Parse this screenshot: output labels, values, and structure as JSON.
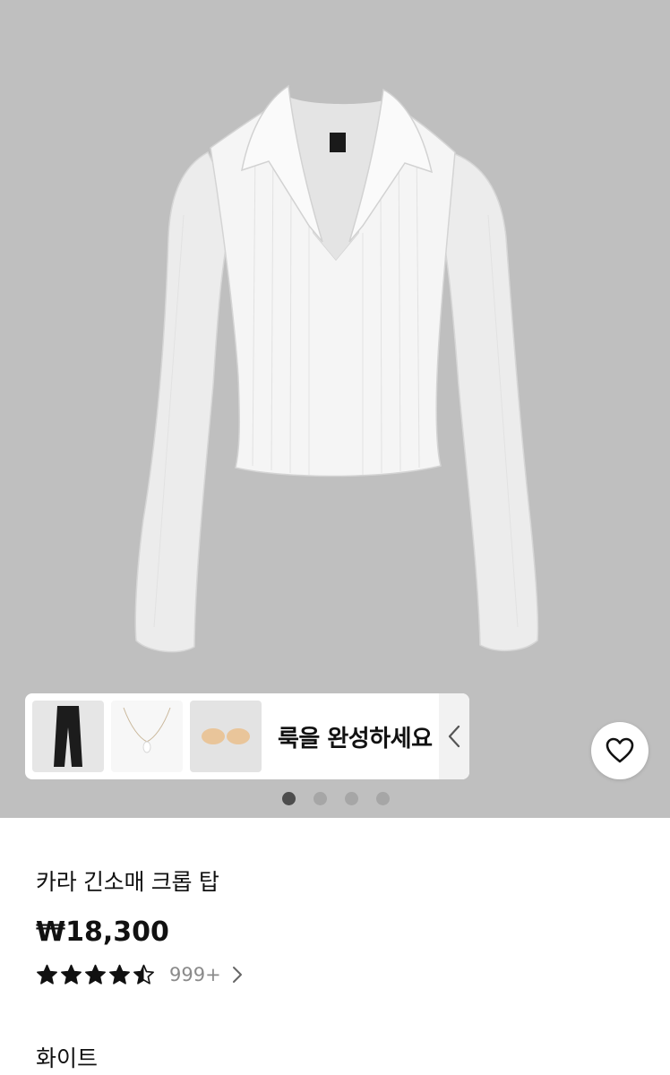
{
  "gallery": {
    "look_label": "룩을 완성하세요",
    "dots": [
      {
        "active": true
      },
      {
        "active": false
      },
      {
        "active": false
      },
      {
        "active": false
      }
    ]
  },
  "product": {
    "title": "카라 긴소매 크롭 탑",
    "price": "₩18,300",
    "rating": 4.5,
    "review_count": "999+",
    "color": "화이트"
  },
  "colors": {
    "hero_background": "#bfbfbf",
    "active_dot": "#4d4d4d",
    "inactive_dot": "#a6a6a6"
  },
  "icons": {
    "wishlist": "heart-icon",
    "look_toggle": "chevron-left-icon",
    "reviews_link": "chevron-right-icon"
  }
}
